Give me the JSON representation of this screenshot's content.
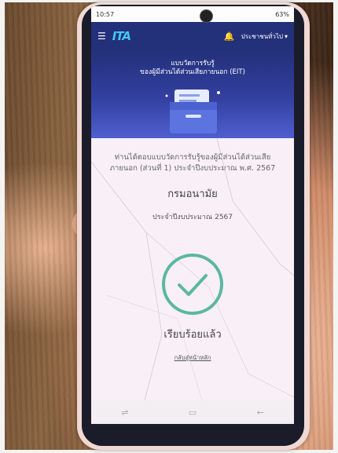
{
  "status_bar": {
    "time": "10:57",
    "battery": "63%"
  },
  "app": {
    "logo": "ITA",
    "role_label": "ประชาชนทั่วไป",
    "role_caret": "▾"
  },
  "hero": {
    "title_line1": "แบบวัดการรับรู้",
    "title_line2": "ของผู้มีส่วนได้ส่วนเสียภายนอก (EIT)"
  },
  "card": {
    "intro_line1": "ท่านได้ตอบแบบวัดการรับรู้ของผู้มีส่วนได้ส่วนเสีย",
    "intro_line2": "ภายนอก (ส่วนที่ 1) ประจำปีงบประมาณ พ.ศ. 2567",
    "organization": "กรมอนามัย",
    "fiscal_year": "ประจำปีงบประมาณ 2567",
    "status": "เรียบร้อยแล้ว",
    "home_link": "กลับสู่หน้าหลัก"
  },
  "colors": {
    "header": "#23307a",
    "logo": "#44c8f5",
    "success": "#5bb7a2"
  }
}
